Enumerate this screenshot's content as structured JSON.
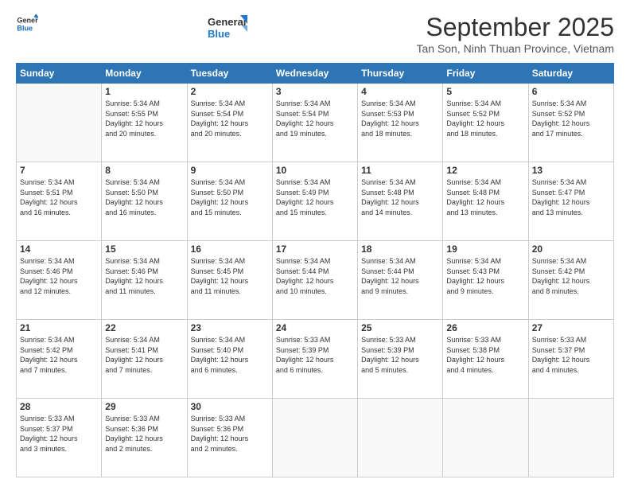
{
  "logo": {
    "text_general": "General",
    "text_blue": "Blue"
  },
  "header": {
    "month": "September 2025",
    "location": "Tan Son, Ninh Thuan Province, Vietnam"
  },
  "days": [
    "Sunday",
    "Monday",
    "Tuesday",
    "Wednesday",
    "Thursday",
    "Friday",
    "Saturday"
  ],
  "weeks": [
    [
      {
        "day": "",
        "text": ""
      },
      {
        "day": "1",
        "text": "Sunrise: 5:34 AM\nSunset: 5:55 PM\nDaylight: 12 hours\nand 20 minutes."
      },
      {
        "day": "2",
        "text": "Sunrise: 5:34 AM\nSunset: 5:54 PM\nDaylight: 12 hours\nand 20 minutes."
      },
      {
        "day": "3",
        "text": "Sunrise: 5:34 AM\nSunset: 5:54 PM\nDaylight: 12 hours\nand 19 minutes."
      },
      {
        "day": "4",
        "text": "Sunrise: 5:34 AM\nSunset: 5:53 PM\nDaylight: 12 hours\nand 18 minutes."
      },
      {
        "day": "5",
        "text": "Sunrise: 5:34 AM\nSunset: 5:52 PM\nDaylight: 12 hours\nand 18 minutes."
      },
      {
        "day": "6",
        "text": "Sunrise: 5:34 AM\nSunset: 5:52 PM\nDaylight: 12 hours\nand 17 minutes."
      }
    ],
    [
      {
        "day": "7",
        "text": "Sunrise: 5:34 AM\nSunset: 5:51 PM\nDaylight: 12 hours\nand 16 minutes."
      },
      {
        "day": "8",
        "text": "Sunrise: 5:34 AM\nSunset: 5:50 PM\nDaylight: 12 hours\nand 16 minutes."
      },
      {
        "day": "9",
        "text": "Sunrise: 5:34 AM\nSunset: 5:50 PM\nDaylight: 12 hours\nand 15 minutes."
      },
      {
        "day": "10",
        "text": "Sunrise: 5:34 AM\nSunset: 5:49 PM\nDaylight: 12 hours\nand 15 minutes."
      },
      {
        "day": "11",
        "text": "Sunrise: 5:34 AM\nSunset: 5:48 PM\nDaylight: 12 hours\nand 14 minutes."
      },
      {
        "day": "12",
        "text": "Sunrise: 5:34 AM\nSunset: 5:48 PM\nDaylight: 12 hours\nand 13 minutes."
      },
      {
        "day": "13",
        "text": "Sunrise: 5:34 AM\nSunset: 5:47 PM\nDaylight: 12 hours\nand 13 minutes."
      }
    ],
    [
      {
        "day": "14",
        "text": "Sunrise: 5:34 AM\nSunset: 5:46 PM\nDaylight: 12 hours\nand 12 minutes."
      },
      {
        "day": "15",
        "text": "Sunrise: 5:34 AM\nSunset: 5:46 PM\nDaylight: 12 hours\nand 11 minutes."
      },
      {
        "day": "16",
        "text": "Sunrise: 5:34 AM\nSunset: 5:45 PM\nDaylight: 12 hours\nand 11 minutes."
      },
      {
        "day": "17",
        "text": "Sunrise: 5:34 AM\nSunset: 5:44 PM\nDaylight: 12 hours\nand 10 minutes."
      },
      {
        "day": "18",
        "text": "Sunrise: 5:34 AM\nSunset: 5:44 PM\nDaylight: 12 hours\nand 9 minutes."
      },
      {
        "day": "19",
        "text": "Sunrise: 5:34 AM\nSunset: 5:43 PM\nDaylight: 12 hours\nand 9 minutes."
      },
      {
        "day": "20",
        "text": "Sunrise: 5:34 AM\nSunset: 5:42 PM\nDaylight: 12 hours\nand 8 minutes."
      }
    ],
    [
      {
        "day": "21",
        "text": "Sunrise: 5:34 AM\nSunset: 5:42 PM\nDaylight: 12 hours\nand 7 minutes."
      },
      {
        "day": "22",
        "text": "Sunrise: 5:34 AM\nSunset: 5:41 PM\nDaylight: 12 hours\nand 7 minutes."
      },
      {
        "day": "23",
        "text": "Sunrise: 5:34 AM\nSunset: 5:40 PM\nDaylight: 12 hours\nand 6 minutes."
      },
      {
        "day": "24",
        "text": "Sunrise: 5:33 AM\nSunset: 5:39 PM\nDaylight: 12 hours\nand 6 minutes."
      },
      {
        "day": "25",
        "text": "Sunrise: 5:33 AM\nSunset: 5:39 PM\nDaylight: 12 hours\nand 5 minutes."
      },
      {
        "day": "26",
        "text": "Sunrise: 5:33 AM\nSunset: 5:38 PM\nDaylight: 12 hours\nand 4 minutes."
      },
      {
        "day": "27",
        "text": "Sunrise: 5:33 AM\nSunset: 5:37 PM\nDaylight: 12 hours\nand 4 minutes."
      }
    ],
    [
      {
        "day": "28",
        "text": "Sunrise: 5:33 AM\nSunset: 5:37 PM\nDaylight: 12 hours\nand 3 minutes."
      },
      {
        "day": "29",
        "text": "Sunrise: 5:33 AM\nSunset: 5:36 PM\nDaylight: 12 hours\nand 2 minutes."
      },
      {
        "day": "30",
        "text": "Sunrise: 5:33 AM\nSunset: 5:36 PM\nDaylight: 12 hours\nand 2 minutes."
      },
      {
        "day": "",
        "text": ""
      },
      {
        "day": "",
        "text": ""
      },
      {
        "day": "",
        "text": ""
      },
      {
        "day": "",
        "text": ""
      }
    ]
  ]
}
